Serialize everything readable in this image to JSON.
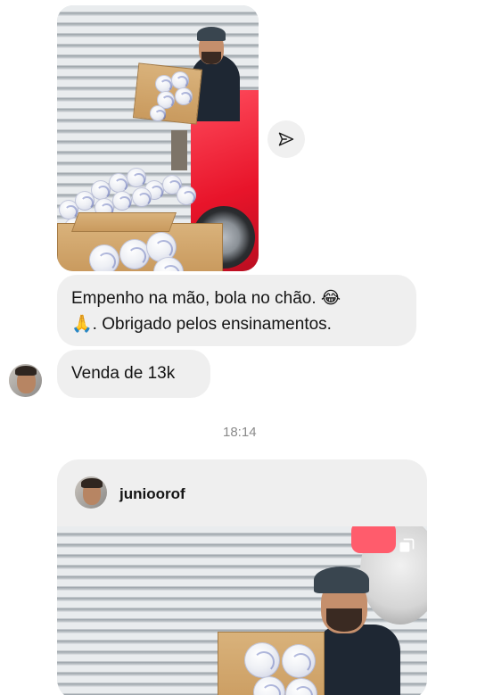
{
  "messages": [
    {
      "type": "photo"
    },
    {
      "type": "text",
      "line1": "Empenho  na  mão, bola no chão.  ",
      "emoji1": "😂",
      "emoji2": "🙏",
      "line2": ". Obrigado pelos ensinamentos."
    },
    {
      "type": "text",
      "text": "Venda  de 13k"
    }
  ],
  "timestamp": "18:14",
  "shared_post": {
    "username": "junioorof"
  },
  "icons": {
    "share": "send-icon",
    "multi": "multiple-photos-icon"
  },
  "colors": {
    "bubble": "#efefef",
    "timestamp": "#8a8a8a",
    "car": "#e8142a"
  }
}
